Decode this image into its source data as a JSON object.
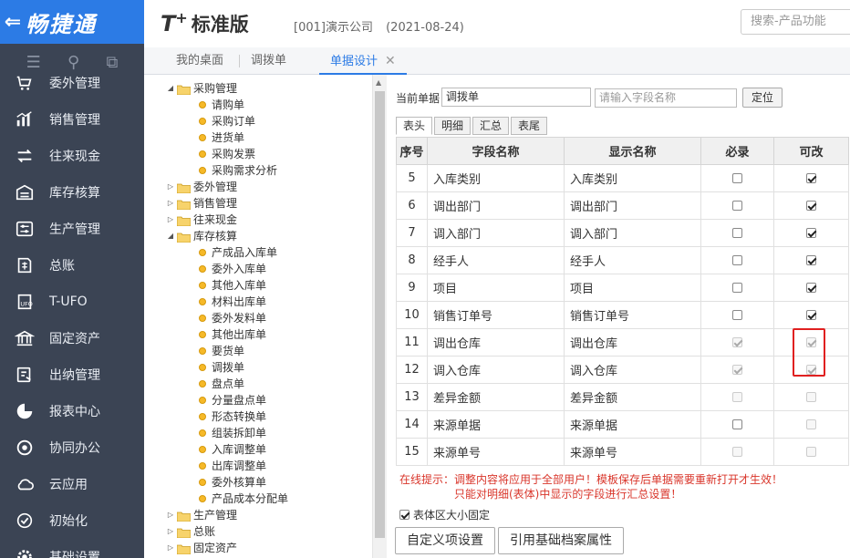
{
  "header": {
    "brand_name": "畅捷通",
    "product_logo": "T",
    "product_logo_sup": "+",
    "product_edition": "标准版",
    "company": "[001]演示公司",
    "date": "(2021-08-24)",
    "search_placeholder": "搜索-产品功能"
  },
  "sidebar": {
    "items": [
      {
        "label": "委外管理",
        "icon": "cart-icon"
      },
      {
        "label": "销售管理",
        "icon": "chart-icon"
      },
      {
        "label": "往来现金",
        "icon": "exchange-icon"
      },
      {
        "label": "库存核算",
        "icon": "warehouse-icon"
      },
      {
        "label": "生产管理",
        "icon": "sliders-icon"
      },
      {
        "label": "总账",
        "icon": "ledger-icon"
      },
      {
        "label": "T-UFO",
        "icon": "ufo-icon"
      },
      {
        "label": "固定资产",
        "icon": "bank-icon"
      },
      {
        "label": "出纳管理",
        "icon": "cashier-icon"
      },
      {
        "label": "报表中心",
        "icon": "pie-icon"
      },
      {
        "label": "协同办公",
        "icon": "cycle-icon"
      },
      {
        "label": "云应用",
        "icon": "cloud-icon"
      },
      {
        "label": "初始化",
        "icon": "init-icon"
      },
      {
        "label": "基础设置",
        "icon": "gear-icon"
      }
    ]
  },
  "tabs": [
    {
      "label": "我的桌面"
    },
    {
      "label": "调拨单"
    },
    {
      "label": "单据设计",
      "active": true
    }
  ],
  "tree": [
    {
      "label": "采购管理",
      "type": "folder",
      "open": true,
      "level": 0
    },
    {
      "label": "请购单",
      "type": "leaf",
      "level": 1
    },
    {
      "label": "采购订单",
      "type": "leaf",
      "level": 1
    },
    {
      "label": "进货单",
      "type": "leaf",
      "level": 1
    },
    {
      "label": "采购发票",
      "type": "leaf",
      "level": 1
    },
    {
      "label": "采购需求分析",
      "type": "leaf",
      "level": 1
    },
    {
      "label": "委外管理",
      "type": "folder",
      "open": false,
      "level": 0
    },
    {
      "label": "销售管理",
      "type": "folder",
      "open": false,
      "level": 0
    },
    {
      "label": "往来现金",
      "type": "folder",
      "open": false,
      "level": 0
    },
    {
      "label": "库存核算",
      "type": "folder",
      "open": true,
      "level": 0
    },
    {
      "label": "产成品入库单",
      "type": "leaf",
      "level": 1
    },
    {
      "label": "委外入库单",
      "type": "leaf",
      "level": 1
    },
    {
      "label": "其他入库单",
      "type": "leaf",
      "level": 1
    },
    {
      "label": "材料出库单",
      "type": "leaf",
      "level": 1
    },
    {
      "label": "委外发料单",
      "type": "leaf",
      "level": 1
    },
    {
      "label": "其他出库单",
      "type": "leaf",
      "level": 1
    },
    {
      "label": "要货单",
      "type": "leaf",
      "level": 1
    },
    {
      "label": "调拨单",
      "type": "leaf",
      "level": 1
    },
    {
      "label": "盘点单",
      "type": "leaf",
      "level": 1
    },
    {
      "label": "分量盘点单",
      "type": "leaf",
      "level": 1
    },
    {
      "label": "形态转换单",
      "type": "leaf",
      "level": 1
    },
    {
      "label": "组装拆卸单",
      "type": "leaf",
      "level": 1
    },
    {
      "label": "入库调整单",
      "type": "leaf",
      "level": 1
    },
    {
      "label": "出库调整单",
      "type": "leaf",
      "level": 1
    },
    {
      "label": "委外核算单",
      "type": "leaf",
      "level": 1
    },
    {
      "label": "产品成本分配单",
      "type": "leaf",
      "level": 1
    },
    {
      "label": "生产管理",
      "type": "folder",
      "open": false,
      "level": 0
    },
    {
      "label": "总账",
      "type": "folder",
      "open": false,
      "level": 0
    },
    {
      "label": "固定资产",
      "type": "folder",
      "open": false,
      "level": 0
    }
  ],
  "panel": {
    "current_label": "当前单据",
    "current_value": "调拨单",
    "field_placeholder": "请输入字段名称",
    "locate_label": "定位",
    "subtabs": [
      "表头",
      "明细",
      "汇总",
      "表尾"
    ],
    "columns": [
      "序号",
      "字段名称",
      "显示名称",
      "必录",
      "可改"
    ],
    "rows": [
      {
        "no": "5",
        "field": "入库类别",
        "display": "入库类别",
        "required": false,
        "req_dis": false,
        "editable": true,
        "edit_dis": false
      },
      {
        "no": "6",
        "field": "调出部门",
        "display": "调出部门",
        "required": false,
        "req_dis": false,
        "editable": true,
        "edit_dis": false
      },
      {
        "no": "7",
        "field": "调入部门",
        "display": "调入部门",
        "required": false,
        "req_dis": false,
        "editable": true,
        "edit_dis": false
      },
      {
        "no": "8",
        "field": "经手人",
        "display": "经手人",
        "required": false,
        "req_dis": false,
        "editable": true,
        "edit_dis": false
      },
      {
        "no": "9",
        "field": "项目",
        "display": "项目",
        "required": false,
        "req_dis": false,
        "editable": true,
        "edit_dis": false
      },
      {
        "no": "10",
        "field": "销售订单号",
        "display": "销售订单号",
        "required": false,
        "req_dis": false,
        "editable": true,
        "edit_dis": false
      },
      {
        "no": "11",
        "field": "调出仓库",
        "display": "调出仓库",
        "required": true,
        "req_dis": true,
        "editable": true,
        "edit_dis": true
      },
      {
        "no": "12",
        "field": "调入仓库",
        "display": "调入仓库",
        "required": true,
        "req_dis": true,
        "editable": true,
        "edit_dis": true
      },
      {
        "no": "13",
        "field": "差异金额",
        "display": "差异金额",
        "required": false,
        "req_dis": true,
        "editable": false,
        "edit_dis": true
      },
      {
        "no": "14",
        "field": "来源单据",
        "display": "来源单据",
        "required": false,
        "req_dis": false,
        "editable": false,
        "edit_dis": true
      },
      {
        "no": "15",
        "field": "来源单号",
        "display": "来源单号",
        "required": false,
        "req_dis": true,
        "editable": false,
        "edit_dis": true
      }
    ],
    "hint_line1": "在线提示：调整内容将应用于全部用户！模板保存后单据需要重新打开才生效！",
    "hint_line2": "只能对明细(表体)中显示的字段进行汇总设置！",
    "fixed_label": "表体区大小固定",
    "fixed_checked": true,
    "custom_button": "自定义项设置",
    "ref_button": "引用基础档案属性"
  },
  "colors": {
    "brand": "#2c7be5",
    "sidebar": "#3b4454",
    "hint": "#d9362b",
    "highlight": "#e02020"
  }
}
